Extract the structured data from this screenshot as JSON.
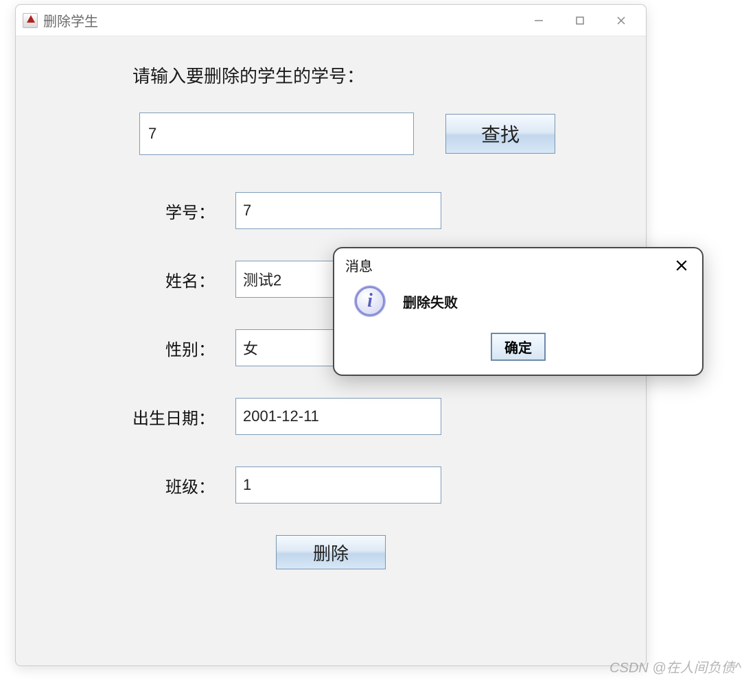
{
  "window": {
    "title": "删除学生"
  },
  "prompt": "请输入要删除的学生的学号：",
  "search": {
    "value": "7",
    "button_label": "查找"
  },
  "fields": {
    "id": {
      "label": "学号：",
      "value": "7"
    },
    "name": {
      "label": "姓名：",
      "value": "测试2"
    },
    "gender": {
      "label": "性别：",
      "value": "女"
    },
    "birth": {
      "label": "出生日期：",
      "value": "2001-12-11"
    },
    "class": {
      "label": "班级：",
      "value": "1"
    }
  },
  "delete_button": "删除",
  "dialog": {
    "title": "消息",
    "message": "删除失败",
    "ok": "确定"
  },
  "watermark": "CSDN @在人间负债^"
}
